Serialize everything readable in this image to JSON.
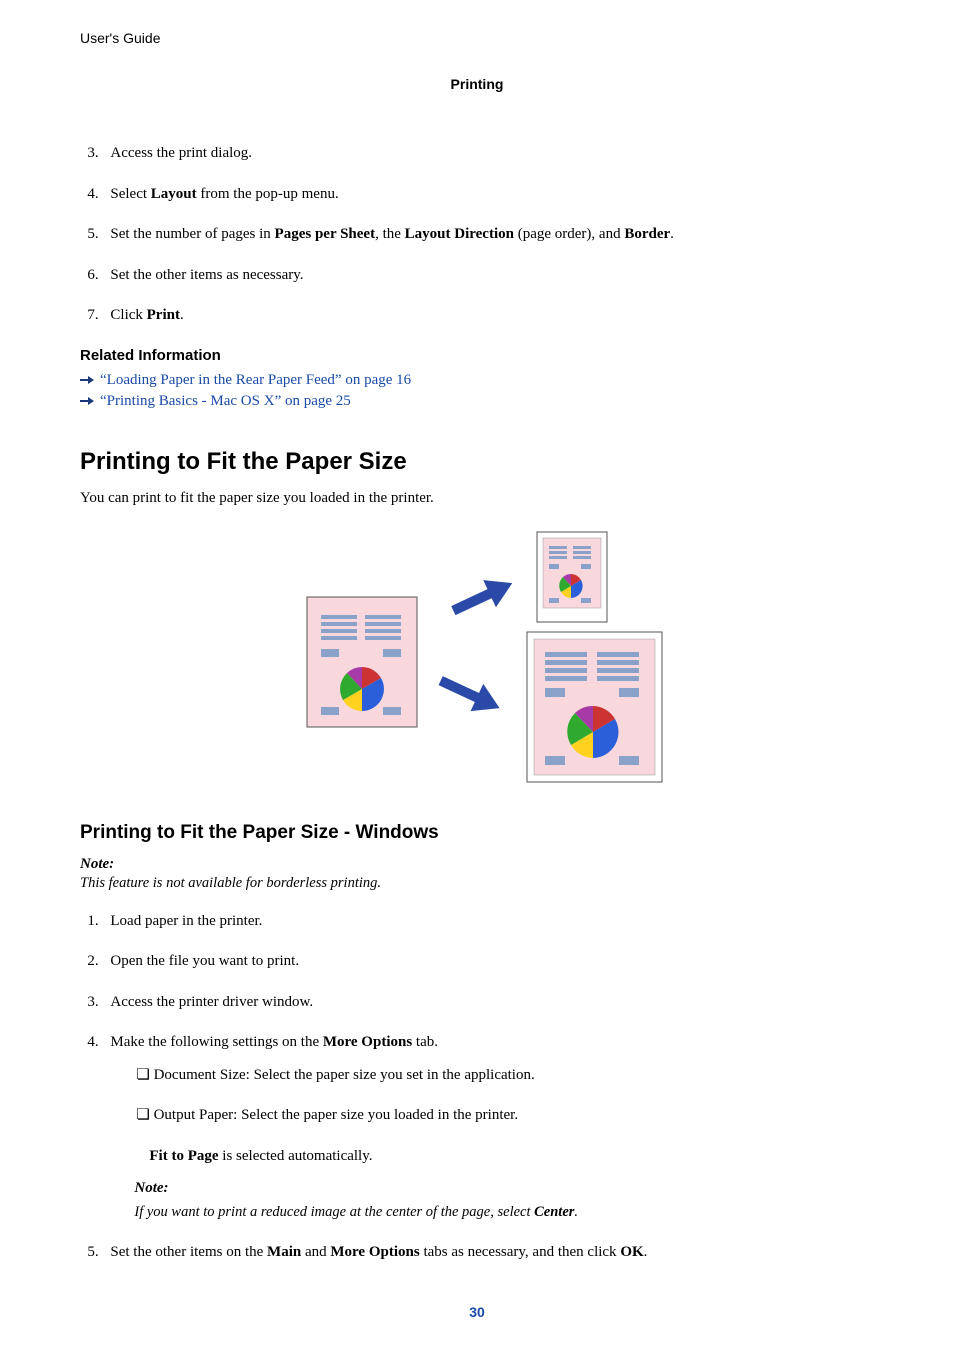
{
  "header": {
    "guide_label": "User's Guide",
    "section": "Printing"
  },
  "steps_a": {
    "s3": "Access the print dialog.",
    "s4_pre": "Select ",
    "s4_bold": "Layout",
    "s4_post": " from the pop-up menu.",
    "s5_pre": "Set the number of pages in ",
    "s5_b1": "Pages per Sheet",
    "s5_mid1": ", the ",
    "s5_b2": "Layout Direction",
    "s5_mid2": " (page order), and ",
    "s5_b3": "Border",
    "s5_post": ".",
    "s6": "Set the other items as necessary.",
    "s7_pre": "Click ",
    "s7_bold": "Print",
    "s7_post": "."
  },
  "related": {
    "heading": "Related Information",
    "link1": "“Loading Paper in the Rear Paper Feed” on page 16",
    "link2": "“Printing Basics - Mac OS X” on page 25"
  },
  "h2": "Printing to Fit the Paper Size",
  "intro": "You can print to fit the paper size you loaded in the printer.",
  "h3": "Printing to Fit the Paper Size - Windows",
  "note1": {
    "label": "Note:",
    "body": "This feature is not available for borderless printing."
  },
  "steps_b": {
    "s1": "Load paper in the printer.",
    "s2": "Open the file you want to print.",
    "s3": "Access the printer driver window.",
    "s4_pre": "Make the following settings on the ",
    "s4_bold": "More Options",
    "s4_post": " tab.",
    "sub1": "Document Size: Select the paper size you set in the application.",
    "sub2": "Output Paper: Select the paper size you loaded in the printer.",
    "sub_auto_bold": "Fit to Page",
    "sub_auto_post": " is selected automatically.",
    "inner_note_label": "Note:",
    "inner_note_pre": "If you want to print a reduced image at the center of the page, select ",
    "inner_note_bold": "Center",
    "inner_note_post": ".",
    "s5_pre": "Set the other items on the ",
    "s5_b1": "Main",
    "s5_mid": " and ",
    "s5_b2": "More Options",
    "s5_mid2": " tabs as necessary, and then click ",
    "s5_b3": "OK",
    "s5_post": "."
  },
  "page_number": "30"
}
